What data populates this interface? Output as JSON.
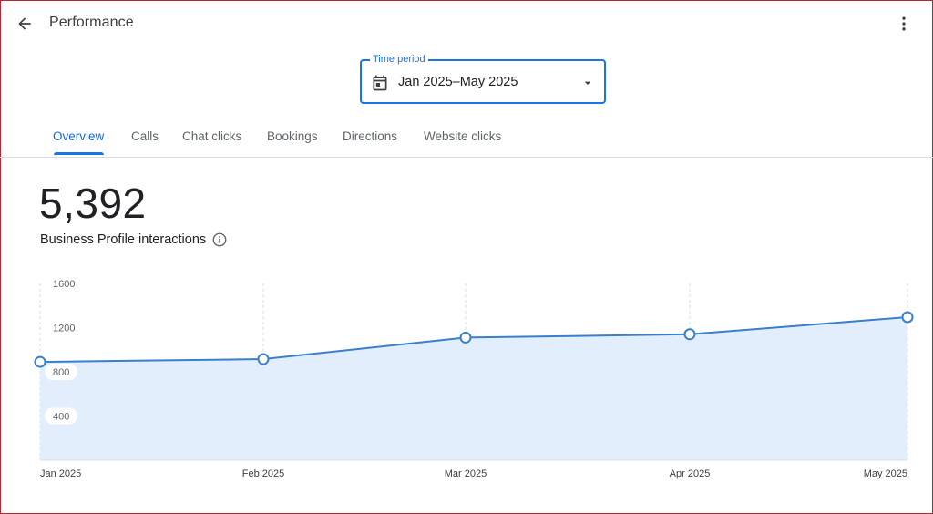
{
  "header": {
    "title": "Performance",
    "back_icon": "arrow-back-icon",
    "more_icon": "more-vert-icon"
  },
  "time_period": {
    "label": "Time period",
    "value": "Jan 2025–May 2025",
    "icon": "calendar-icon",
    "dropdown_icon": "arrow-drop-down-icon"
  },
  "tabs": [
    {
      "label": "Overview",
      "active": true
    },
    {
      "label": "Calls",
      "active": false
    },
    {
      "label": "Chat clicks",
      "active": false
    },
    {
      "label": "Bookings",
      "active": false
    },
    {
      "label": "Directions",
      "active": false
    },
    {
      "label": "Website clicks",
      "active": false
    }
  ],
  "metric": {
    "value": "5,392",
    "label": "Business Profile interactions",
    "info_icon": "info-icon"
  },
  "colors": {
    "accent": "#1a73e8",
    "line": "#3a7fcb",
    "area": "#e3eefc"
  },
  "chart_data": {
    "type": "area",
    "x": [
      "Jan 2025",
      "Feb 2025",
      "Mar 2025",
      "Apr 2025",
      "May 2025"
    ],
    "series": [
      {
        "values": [
          890,
          915,
          1110,
          1140,
          1295
        ]
      }
    ],
    "yticks": [
      "1600",
      "1200",
      "800",
      "400"
    ],
    "ylim": [
      0,
      1600
    ],
    "grid": "vertical-dashed"
  }
}
